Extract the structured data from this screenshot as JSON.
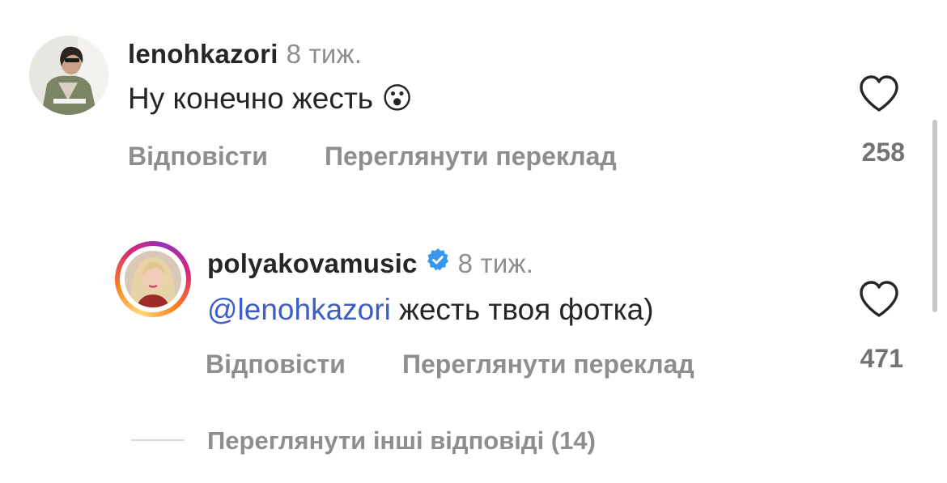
{
  "comments": [
    {
      "username": "lenohkazori",
      "time": "8 тиж.",
      "text": "Ну конечно жесть 😮",
      "reply_label": "Відповісти",
      "translate_label": "Переглянути переклад",
      "likes": "258"
    },
    {
      "username": "polyakovamusic",
      "verified": true,
      "time": "8 тиж.",
      "mention": "@lenohkazori",
      "text": " жесть твоя фотка)",
      "reply_label": "Відповісти",
      "translate_label": "Переглянути переклад",
      "likes": "471"
    }
  ],
  "view_more_replies": "Переглянути інші відповіді (14)",
  "colors": {
    "mention": "#3b5ec9",
    "verified": "#3897f0",
    "muted_text": "#8e8e8e"
  }
}
